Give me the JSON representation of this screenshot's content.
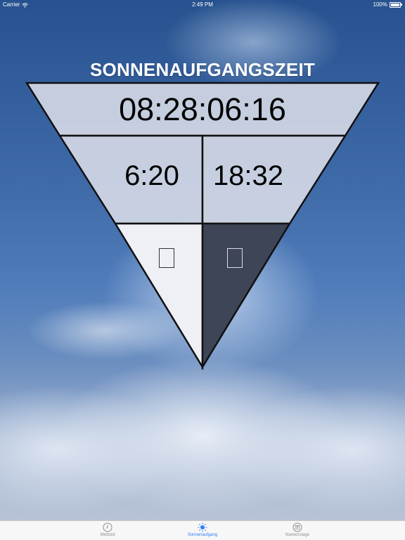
{
  "status_bar": {
    "carrier": "Carrier",
    "time": "2:49 PM",
    "battery": "100%"
  },
  "title": "SONNENAUFGANGSZEIT",
  "countdown": "08:28:06:16",
  "sunrise_time": "6:20",
  "sunset_time": "18:32",
  "colors": {
    "tab_active": "#2f7cf6",
    "tab_inactive": "#8e8e93",
    "panel_top": "#d9dde8",
    "panel_light": "#eef0f5",
    "panel_dark": "#3d4556"
  },
  "tabs": [
    {
      "label": "Weltzeit",
      "icon": "clock-icon",
      "active": false
    },
    {
      "label": "Sonnenaufgang",
      "icon": "sun-icon",
      "active": true
    },
    {
      "label": "Namenstage",
      "icon": "people-icon",
      "active": false
    }
  ]
}
